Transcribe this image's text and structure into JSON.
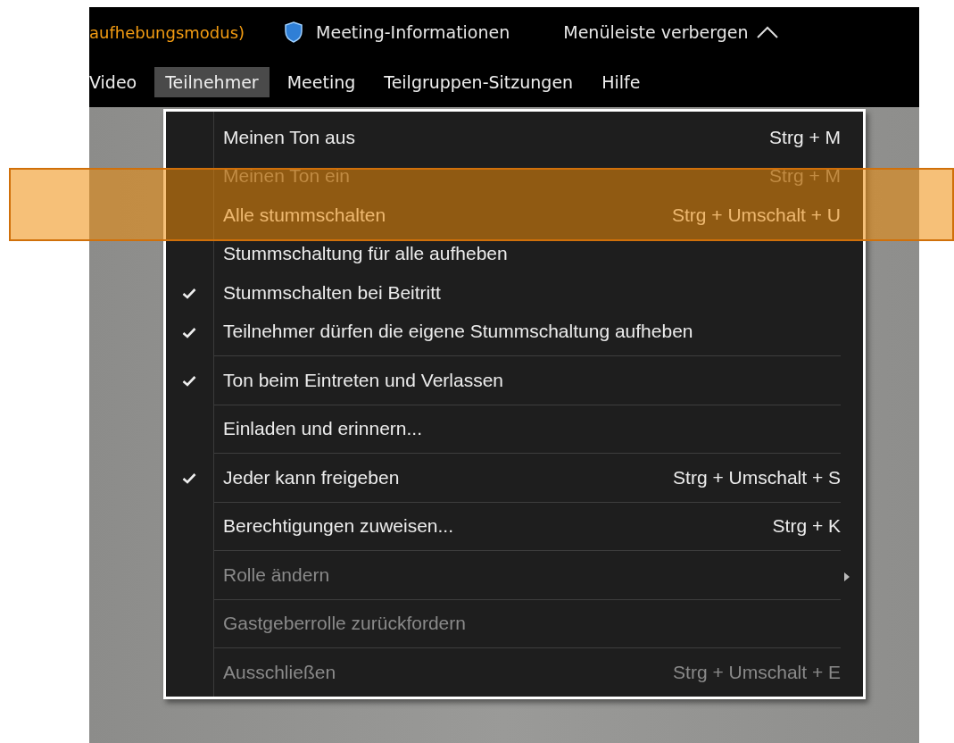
{
  "top_bar": {
    "status_text": "aufhebungsmodus)",
    "info_label": "Meeting-Informationen",
    "hide_label": "Menüleiste verbergen"
  },
  "menu_bar": [
    {
      "label": "Video",
      "selected": false
    },
    {
      "label": "Teilnehmer",
      "selected": true
    },
    {
      "label": "Meeting",
      "selected": false
    },
    {
      "label": "Teilgruppen-Sitzungen",
      "selected": false
    },
    {
      "label": "Hilfe",
      "selected": false
    }
  ],
  "menu_groups": [
    [
      {
        "label": "Meinen Ton aus",
        "shortcut": "Strg + M",
        "checked": false,
        "disabled": false
      },
      {
        "label": "Meinen Ton ein",
        "shortcut": "Strg + M",
        "checked": false,
        "disabled": true
      },
      {
        "label": "Alle stummschalten",
        "shortcut": "Strg + Umschalt + U",
        "checked": false,
        "disabled": false
      },
      {
        "label": "Stummschaltung für alle aufheben",
        "checked": false,
        "disabled": false
      },
      {
        "label": "Stummschalten bei Beitritt",
        "checked": true,
        "disabled": false
      },
      {
        "label": "Teilnehmer dürfen die eigene Stummschaltung aufheben",
        "checked": true,
        "disabled": false
      }
    ],
    [
      {
        "label": "Ton beim Eintreten und Verlassen",
        "checked": true,
        "disabled": false
      }
    ],
    [
      {
        "label": "Einladen und erinnern...",
        "checked": false,
        "disabled": false
      }
    ],
    [
      {
        "label": "Jeder kann freigeben",
        "shortcut": "Strg + Umschalt + S",
        "checked": true,
        "disabled": false
      }
    ],
    [
      {
        "label": "Berechtigungen zuweisen...",
        "shortcut": "Strg + K",
        "checked": false,
        "disabled": false
      }
    ],
    [
      {
        "label": "Rolle ändern",
        "checked": false,
        "disabled": true,
        "submenu": true
      }
    ],
    [
      {
        "label": "Gastgeberrolle zurückfordern",
        "checked": false,
        "disabled": true
      }
    ],
    [
      {
        "label": "Ausschließen",
        "shortcut": "Strg + Umschalt + E",
        "checked": false,
        "disabled": true
      }
    ]
  ]
}
